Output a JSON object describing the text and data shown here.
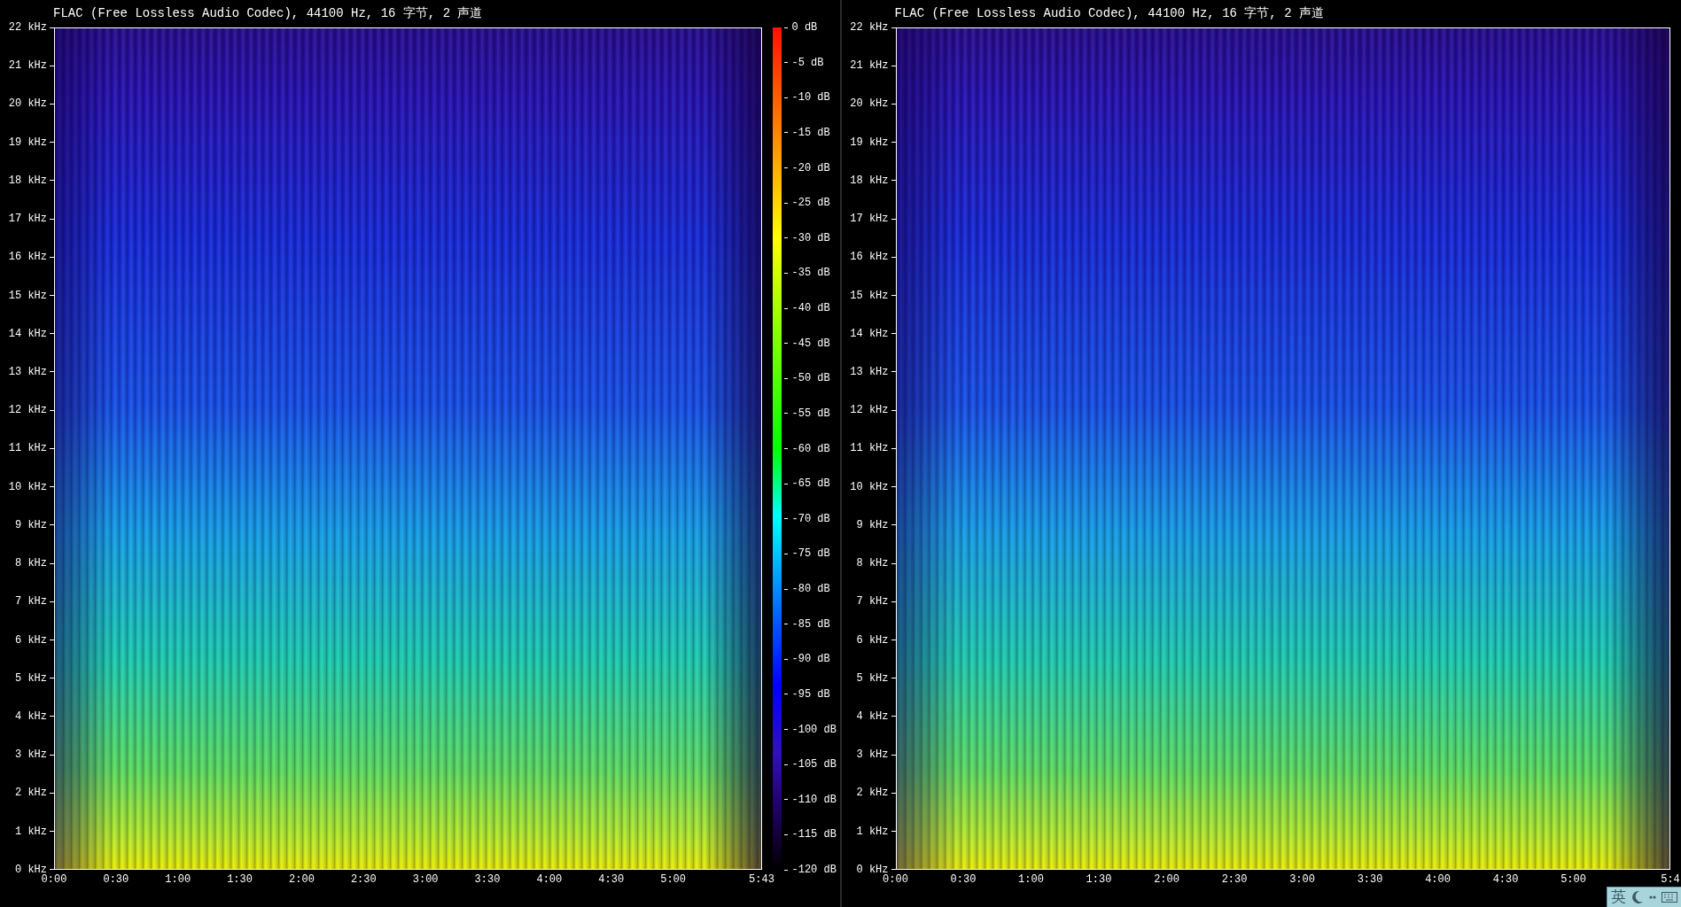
{
  "panels": [
    {
      "title": "FLAC (Free Lossless Audio Codec), 44100 Hz, 16 字节, 2 声道",
      "y_ticks": [
        "22 kHz",
        "21 kHz",
        "20 kHz",
        "19 kHz",
        "18 kHz",
        "17 kHz",
        "16 kHz",
        "15 kHz",
        "14 kHz",
        "13 kHz",
        "12 kHz",
        "11 kHz",
        "10 kHz",
        "9 kHz",
        "8 kHz",
        "7 kHz",
        "6 kHz",
        "5 kHz",
        "4 kHz",
        "3 kHz",
        "2 kHz",
        "1 kHz",
        "0 kHz"
      ],
      "x_ticks": [
        "0:00",
        "0:30",
        "1:00",
        "1:30",
        "2:00",
        "2:30",
        "3:00",
        "3:30",
        "4:00",
        "4:30",
        "5:00",
        "5:43"
      ],
      "colorbar": {
        "ticks": [
          "0 dB",
          "-5 dB",
          "-10 dB",
          "-15 dB",
          "-20 dB",
          "-25 dB",
          "-30 dB",
          "-35 dB",
          "-40 dB",
          "-45 dB",
          "-50 dB",
          "-55 dB",
          "-60 dB",
          "-65 dB",
          "-70 dB",
          "-75 dB",
          "-80 dB",
          "-85 dB",
          "-90 dB",
          "-95 dB",
          "-100 dB",
          "-105 dB",
          "-110 dB",
          "-115 dB",
          "-120 dB"
        ]
      }
    },
    {
      "title": "FLAC (Free Lossless Audio Codec), 44100 Hz, 16 字节, 2 声道",
      "y_ticks": [
        "22 kHz",
        "21 kHz",
        "20 kHz",
        "19 kHz",
        "18 kHz",
        "17 kHz",
        "16 kHz",
        "15 kHz",
        "14 kHz",
        "13 kHz",
        "12 kHz",
        "11 kHz",
        "10 kHz",
        "9 kHz",
        "8 kHz",
        "7 kHz",
        "6 kHz",
        "5 kHz",
        "4 kHz",
        "3 kHz",
        "2 kHz",
        "1 kHz",
        "0 kHz"
      ],
      "x_ticks": [
        "0:00",
        "0:30",
        "1:00",
        "1:30",
        "2:00",
        "2:30",
        "3:00",
        "3:30",
        "4:00",
        "4:30",
        "5:00",
        "5:4"
      ]
    }
  ],
  "ime_bar": {
    "label": "英"
  }
}
